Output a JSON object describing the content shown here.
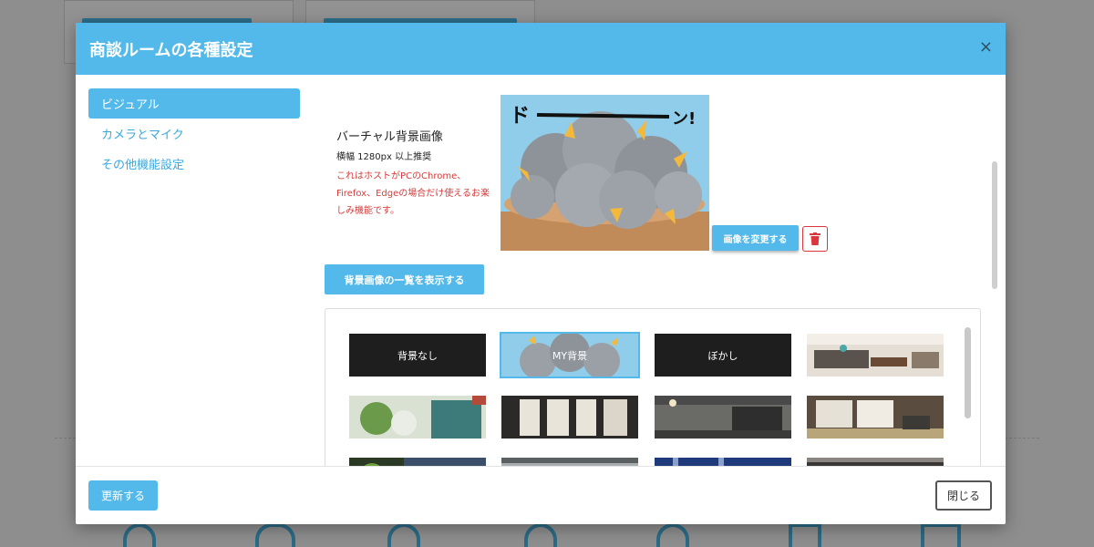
{
  "modal": {
    "title": "商談ルームの各種設定",
    "close_icon": "×"
  },
  "sidebar": {
    "items": [
      {
        "label": "ビジュアル",
        "active": true
      },
      {
        "label": "カメラとマイク",
        "active": false
      },
      {
        "label": "その他機能設定",
        "active": false
      }
    ]
  },
  "virtual_background": {
    "title": "バーチャル背景画像",
    "recommendation": "横幅 1280px 以上推奨",
    "note": "これはホストがPCのChrome、Firefox、Edgeの場合だけ使えるお楽しみ機能です。",
    "change_button": "画像を変更する",
    "delete_icon": "trash-icon"
  },
  "background_list": {
    "show_button": "背景画像の一覧を表示する",
    "thumbnails": [
      {
        "label": "背景なし",
        "kind": "none"
      },
      {
        "label": "MY背景",
        "kind": "my",
        "selected": true
      },
      {
        "label": "ぼかし",
        "kind": "blur"
      },
      {
        "label": "",
        "kind": "living-room"
      },
      {
        "label": "",
        "kind": "garden"
      },
      {
        "label": "",
        "kind": "cafe-menu"
      },
      {
        "label": "",
        "kind": "brick-kitchen"
      },
      {
        "label": "",
        "kind": "japanese-room"
      },
      {
        "label": "",
        "kind": "plant"
      },
      {
        "label": "",
        "kind": "window"
      },
      {
        "label": "",
        "kind": "blue-room"
      },
      {
        "label": "",
        "kind": "dark-room"
      }
    ]
  },
  "footer": {
    "update_button": "更新する",
    "close_button": "閉じる"
  },
  "colors": {
    "accent": "#52b9ea",
    "danger": "#d9363e"
  }
}
